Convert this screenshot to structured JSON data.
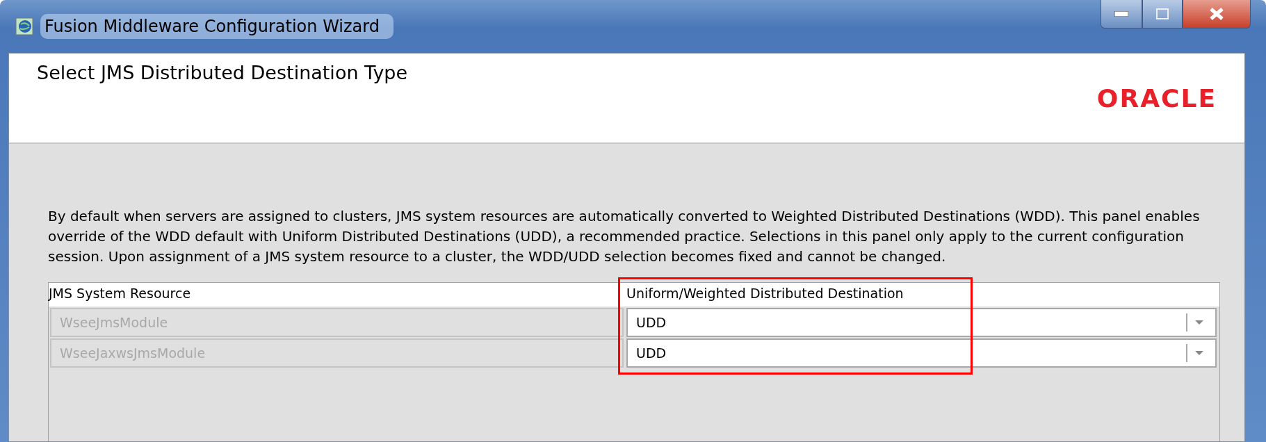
{
  "window": {
    "title": "Fusion Middleware Configuration Wizard"
  },
  "header": {
    "title": "Select JMS Distributed Destination Type",
    "logo": "ORACLE"
  },
  "description": "By default when servers are assigned to clusters, JMS system resources are automatically converted to Weighted Distributed Destinations (WDD).  This panel enables override of the WDD default with Uniform Distributed Destinations (UDD), a recommended practice.  Selections in this panel only apply to the current configuration session.  Upon assignment of a JMS system resource to a cluster, the WDD/UDD selection becomes fixed and cannot be changed.",
  "table": {
    "columns": [
      {
        "label": "JMS System Resource",
        "highlighted": false
      },
      {
        "label": "Uniform/Weighted Distributed Destination",
        "highlighted": true
      }
    ],
    "rows": [
      {
        "resource": "WseeJmsModule",
        "disabled": true,
        "destination": "UDD"
      },
      {
        "resource": "WseeJaxwsJmsModule",
        "disabled": true,
        "destination": "UDD"
      }
    ]
  }
}
